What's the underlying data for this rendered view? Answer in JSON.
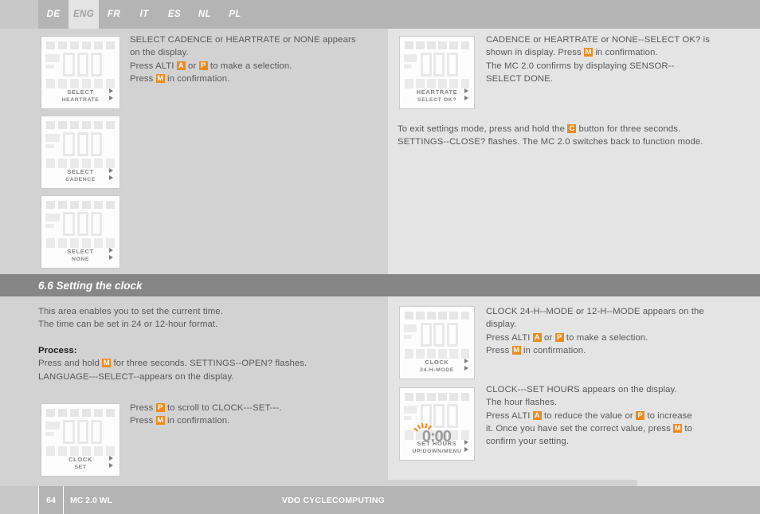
{
  "language_tabs": [
    {
      "label": "DE",
      "active": false
    },
    {
      "label": "ENG",
      "active": true
    },
    {
      "label": "FR",
      "active": false
    },
    {
      "label": "IT",
      "active": false
    },
    {
      "label": "ES",
      "active": false
    },
    {
      "label": "NL",
      "active": false
    },
    {
      "label": "PL",
      "active": false
    }
  ],
  "colors": {
    "key_orange": "#f08a1b",
    "band_gray": "#868686",
    "left_column": "#d2d2d2",
    "right_column": "#e4e4e4",
    "header_gray": "#b4b4b4"
  },
  "top_left": {
    "lcd": [
      {
        "line1": "SELECT",
        "line2": "HEARTRATE"
      },
      {
        "line1": "SELECT",
        "line2": "CADENCE"
      },
      {
        "line1": "SELECT",
        "line2": "NONE"
      }
    ],
    "text_lines": [
      "SELECT CADENCE or HEARTRATE or NONE appears",
      "on the display.",
      "Press ALTI |A| or |P| to make a selection.",
      "Press |M| in confirmation."
    ]
  },
  "top_right": {
    "lcd": {
      "line1": "HEARTRATE",
      "line2": "SELECT OK?"
    },
    "text_lines": [
      "CADENCE or HEARTRATE or NONE--SELECT OK? is",
      "shown in display. Press |M| in confirmation.",
      "The MC 2.0 confirms by displaying SENSOR--",
      "SELECT DONE."
    ],
    "exit_lines": [
      "To exit settings mode, press and hold the |C| button for three seconds.",
      "SETTINGS--CLOSE? flashes. The MC 2.0 switches back to function mode."
    ]
  },
  "section": {
    "number": "6.6",
    "title": "6.6 Setting the clock"
  },
  "clock_left": {
    "intro_lines": [
      "This area enables you to set the current time.",
      "The time can be set in 24 or 12-hour format."
    ],
    "process_label": "Process:",
    "process_lines": [
      "Press and hold |M| for three seconds. SETTINGS--OPEN? flashes.",
      "LANGUAGE---SELECT--appears on the display."
    ],
    "lcd": {
      "line1": "CLOCK",
      "line2": "SET"
    },
    "lcd_text_lines": [
      "Press |P| to scroll to CLOCK---SET---.",
      "Press |M| in confirmation."
    ]
  },
  "clock_right": {
    "block1": {
      "lcd": {
        "line1": "CLOCK",
        "line2": "24-H-MODE"
      },
      "text_lines": [
        "CLOCK 24-H--MODE or 12-H--MODE appears on the",
        "display.",
        "Press ALTI |A| or |P| to make a selection.",
        "Press |M| in confirmation."
      ]
    },
    "block2": {
      "lcd": {
        "line1": "SET  HOURS",
        "line2": "UP/DOWN/MENU",
        "flash_value": "0:00"
      },
      "text_lines": [
        "CLOCK---SET HOURS appears on the display.",
        "The hour flashes.",
        "Press ALTI |A| to reduce the value or |P| to increase",
        "it. Once you have set the correct value, press |M| to",
        "confirm your setting."
      ]
    }
  },
  "footer": {
    "page_number": "64",
    "model": "MC 2.0 WL",
    "brand": "VDO CYCLECOMPUTING"
  }
}
